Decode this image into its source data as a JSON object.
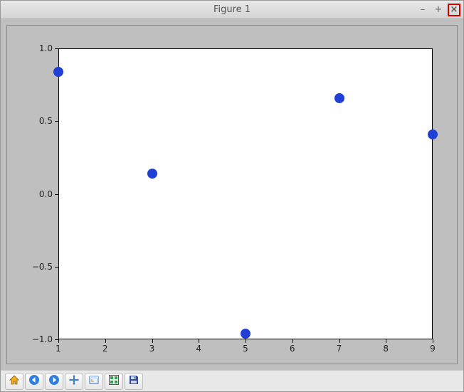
{
  "window": {
    "title": "Figure 1"
  },
  "toolbar": {
    "buttons": [
      "home",
      "back",
      "forward",
      "pan",
      "zoom",
      "subplots",
      "save"
    ]
  },
  "chart_data": {
    "type": "scatter",
    "x": [
      1,
      3,
      5,
      7,
      9
    ],
    "y": [
      0.84,
      0.14,
      -0.96,
      0.66,
      0.41
    ],
    "xlim": [
      1,
      9
    ],
    "ylim": [
      -1.0,
      1.0
    ],
    "xticks": [
      1,
      2,
      3,
      4,
      5,
      6,
      7,
      8,
      9
    ],
    "yticks": [
      -1.0,
      -0.5,
      0.0,
      0.5,
      1.0
    ],
    "ytick_labels": [
      "−1.0",
      "−0.5",
      "0.0",
      "0.5",
      "1.0"
    ],
    "point_color": "#1f3fd6",
    "title": "",
    "xlabel": "",
    "ylabel": ""
  }
}
